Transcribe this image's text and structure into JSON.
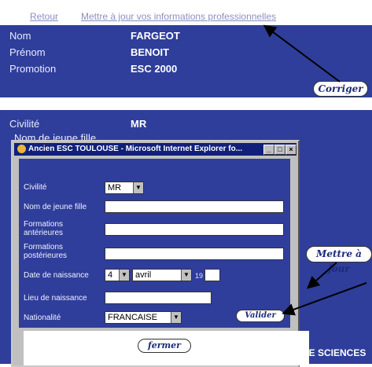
{
  "toplinks": {
    "back": "Retour",
    "update": "Mettre à jour vos informations professionnelles"
  },
  "profile": {
    "nom_label": "Nom",
    "nom_value": "FARGEOT",
    "prenom_label": "Prénom",
    "prenom_value": "BENOIT",
    "promotion_label": "Promotion",
    "promotion_value": "ESC 2000",
    "corriger_label": "Corriger"
  },
  "civil": {
    "civilite_label": "Civilité",
    "civilite_value": "MR",
    "jeune_fille_label": "Nom de jeune fille"
  },
  "dialog": {
    "title": "Ancien ESC TOULOUSE - Microsoft Internet Explorer fo...",
    "civilite_label": "Civilité",
    "civilite_value": "MR",
    "nom_jeune_fille_label": "Nom de jeune fille",
    "nom_jeune_fille_value": "",
    "formations_ant_label": "Formations antérieures",
    "formations_ant_value": "",
    "formations_post_label": "Formations postérieures",
    "formations_post_value": "",
    "date_label": "Date de naissance",
    "day_value": "4",
    "month_value": "avril",
    "year_prefix": "19",
    "year_value": "",
    "lieu_label": "Lieu de naissance",
    "lieu_value": "",
    "nationalite_label": "Nationalité",
    "nationalite_value": "FRANCAISE",
    "valider_label": "Valider",
    "fermer_label": "fermer"
  },
  "mettre_a_jour_label": "Mettre à jour",
  "ecole_text": "DE SCIENCES",
  "colors": {
    "panel": "#2f3e9a",
    "titlebar": "#10207a"
  },
  "icons": [
    "minimize-icon",
    "maximize-icon",
    "close-icon",
    "ie-logo-icon",
    "dropdown-arrow-icon"
  ]
}
